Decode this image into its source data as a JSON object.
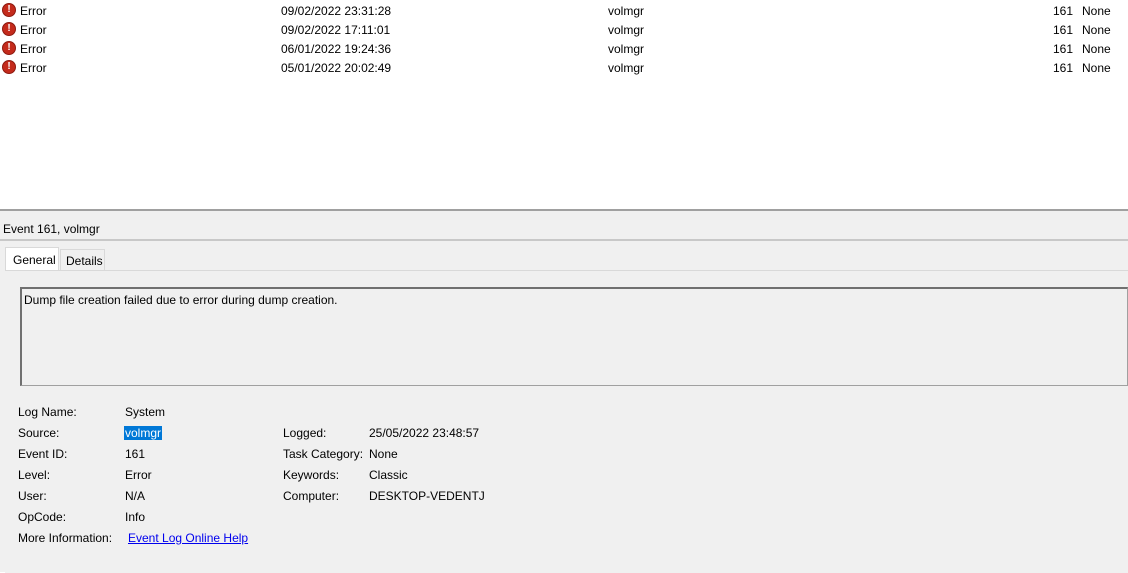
{
  "events": [
    {
      "level": "Error",
      "date": "09/02/2022 23:31:28",
      "source": "volmgr",
      "event_id": "161",
      "category": "None"
    },
    {
      "level": "Error",
      "date": "09/02/2022 17:11:01",
      "source": "volmgr",
      "event_id": "161",
      "category": "None"
    },
    {
      "level": "Error",
      "date": "06/01/2022 19:24:36",
      "source": "volmgr",
      "event_id": "161",
      "category": "None"
    },
    {
      "level": "Error",
      "date": "05/01/2022 20:02:49",
      "source": "volmgr",
      "event_id": "161",
      "category": "None"
    }
  ],
  "detail": {
    "title": "Event 161, volmgr",
    "tabs": [
      "General",
      "Details"
    ],
    "description": "Dump file creation failed due to error during dump creation.",
    "labels": {
      "log_name": "Log Name:",
      "source": "Source:",
      "event_id": "Event ID:",
      "level": "Level:",
      "user": "User:",
      "opcode": "OpCode:",
      "more_info": "More Information:",
      "logged": "Logged:",
      "task_category": "Task Category:",
      "keywords": "Keywords:",
      "computer": "Computer:"
    },
    "values": {
      "log_name": "System",
      "source": "volmgr",
      "event_id": "161",
      "level": "Error",
      "user": "N/A",
      "opcode": "Info",
      "more_info_link": "Event Log Online Help",
      "logged": "25/05/2022 23:48:57",
      "task_category": "None",
      "keywords": "Classic",
      "computer": "DESKTOP-VEDENTJ"
    }
  },
  "colors": {
    "error_icon": "#c42b1c",
    "selection": "#0078d7",
    "link": "#0000ee"
  }
}
